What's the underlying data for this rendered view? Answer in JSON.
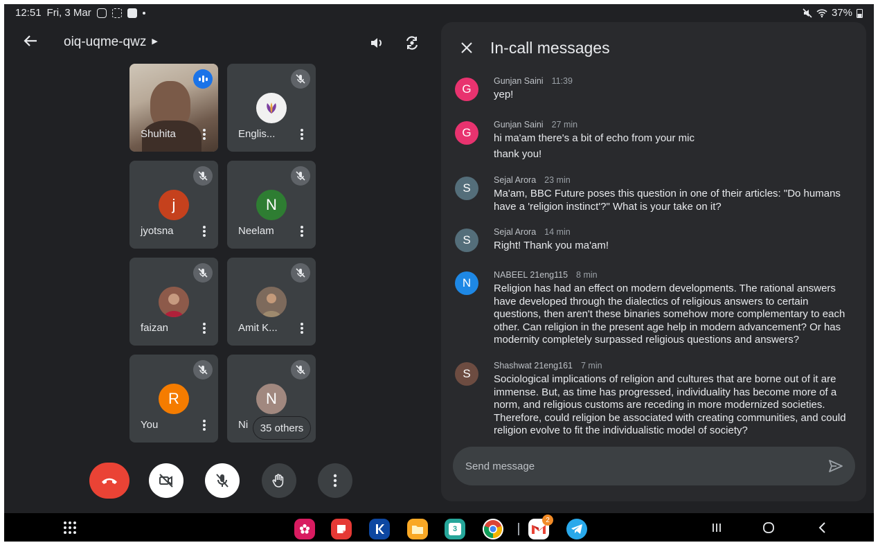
{
  "status_bar": {
    "time": "12:51",
    "date": "Fri, 3 Mar",
    "battery": "37%"
  },
  "header": {
    "meeting_code": "oiq-uqme-qwz"
  },
  "tiles": [
    {
      "name": "Shuhita",
      "initial": "",
      "color": ""
    },
    {
      "name": "Englis...",
      "initial": "",
      "color": ""
    },
    {
      "name": "jyotsna",
      "initial": "j",
      "color": "#c5411d"
    },
    {
      "name": "Neelam",
      "initial": "N",
      "color": "#2e7d32"
    },
    {
      "name": "faizan",
      "initial": "",
      "color": ""
    },
    {
      "name": "Amit K...",
      "initial": "",
      "color": ""
    },
    {
      "name": "You",
      "initial": "R",
      "color": "#f57c00"
    },
    {
      "name": "Ni",
      "initial": "N",
      "color": "#a1887f"
    }
  ],
  "others_label": "35 others",
  "chat": {
    "title": "In-call messages",
    "messages": [
      {
        "initial": "G",
        "color": "#e8336f",
        "sender": "Gunjan Saini",
        "time": "11:39",
        "lines": [
          "yep!"
        ]
      },
      {
        "initial": "G",
        "color": "#e8336f",
        "sender": "Gunjan Saini",
        "time": "27 min",
        "lines": [
          "hi ma'am there's a bit of echo from your mic",
          "thank you!"
        ]
      },
      {
        "initial": "S",
        "color": "#546e7a",
        "sender": "Sejal Arora",
        "time": "23 min",
        "lines": [
          "Ma'am, BBC Future poses this question in one of their articles: \"Do humans have a 'religion instinct'?\" What is your take on it?"
        ]
      },
      {
        "initial": "S",
        "color": "#546e7a",
        "sender": "Sejal Arora",
        "time": "14 min",
        "lines": [
          "Right! Thank you ma'am!"
        ]
      },
      {
        "initial": "N",
        "color": "#1e88e5",
        "sender": "NABEEL 21eng115",
        "time": "8 min",
        "lines": [
          "Religion has had an effect on modern developments. The rational answers have developed through the dialectics of religious answers to certain questions, then aren't these binaries somehow more complementary to each other. Can religion in the present age help in modern advancement? Or has modernity completely surpassed religious questions and answers?"
        ]
      },
      {
        "initial": "S",
        "color": "#6d4c41",
        "sender": "Shashwat 21eng161",
        "time": "7 min",
        "lines": [
          "Sociological implications of religion and cultures that are borne out of it are immense. But, as time has progressed, individuality has become more of a norm, and religious customs are receding in more modernized societies. Therefore, could religion be associated with creating communities, and could religion evolve to fit the individualistic model of society?"
        ]
      }
    ],
    "input_placeholder": "Send message"
  },
  "dock": {
    "gmail_badge": "2",
    "calendar_day": "3"
  }
}
